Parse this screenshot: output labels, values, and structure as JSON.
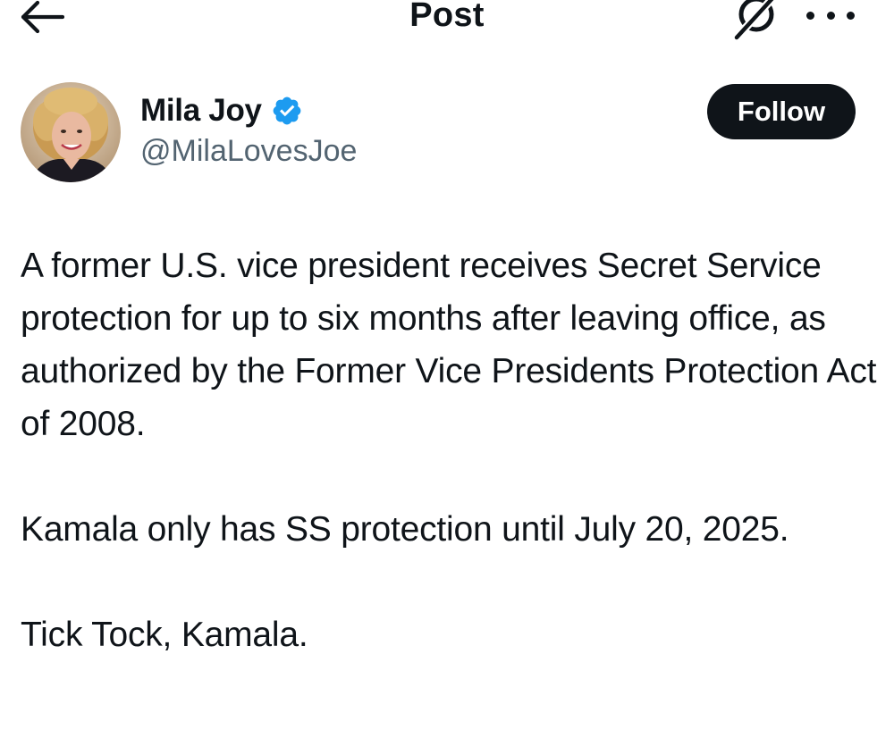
{
  "header": {
    "title": "Post",
    "back_icon": "arrow-left-icon",
    "grok_icon": "grok-icon",
    "more_icon": "more-horizontal-icon"
  },
  "author": {
    "name": "Mila Joy",
    "handle": "@MilaLovesJoe",
    "verified": true,
    "verified_color": "#1d9bf0"
  },
  "follow_button": {
    "label": "Follow"
  },
  "post": {
    "paragraphs": [
      "A former U.S. vice president receives Secret Service protection for up to six months after leaving office, as authorized by the Former Vice Presidents Protection Act of 2008.",
      "Kamala only has SS protection until July 20, 2025.",
      "Tick Tock, Kamala."
    ]
  },
  "colors": {
    "text_primary": "#0f1419",
    "text_secondary": "#536471",
    "button_bg": "#0f1419",
    "button_text": "#ffffff",
    "background": "#ffffff"
  }
}
